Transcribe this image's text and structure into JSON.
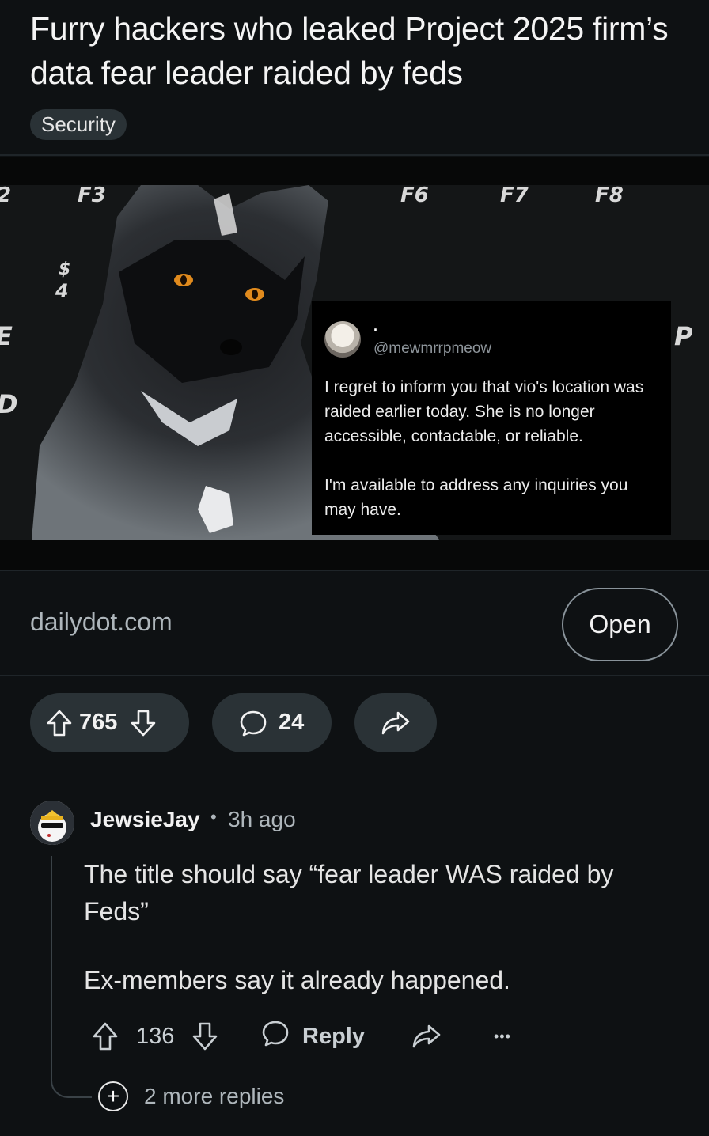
{
  "post": {
    "title": "Furry hackers who leaked Project 2025 firm’s data fear leader raided by feds",
    "flair": "Security"
  },
  "media": {
    "keyboard_keys": [
      "2",
      "F3",
      "F6",
      "F7",
      "F8",
      "$",
      "4",
      "E",
      "D",
      "P"
    ],
    "tweet": {
      "display_name": ".",
      "handle": "@mewmrrpmeow",
      "text": "I regret to inform you that vio's location was raided earlier today. She is no longer accessible, contactable, or reliable.\n\nI'm available to address any inquiries you may have."
    }
  },
  "link": {
    "domain": "dailydot.com",
    "open_label": "Open"
  },
  "actions": {
    "score": "765",
    "comments": "24"
  },
  "comment": {
    "author": "JewsieJay",
    "separator": "•",
    "time": "3h ago",
    "paragraphs": [
      "The title should say “fear leader WAS raided by Feds”",
      "Ex-members say it already happened."
    ],
    "score": "136",
    "reply_label": "Reply",
    "more_label": "•••",
    "more_replies": "2 more replies"
  },
  "colors": {
    "background": "#0e1113",
    "pill": "#2a3236",
    "muted_text": "#aeb6bb"
  },
  "icons": [
    "arrow-up-icon",
    "arrow-down-icon",
    "comment-bubble-icon",
    "share-icon",
    "more-dots-icon",
    "plus-circle-icon"
  ]
}
